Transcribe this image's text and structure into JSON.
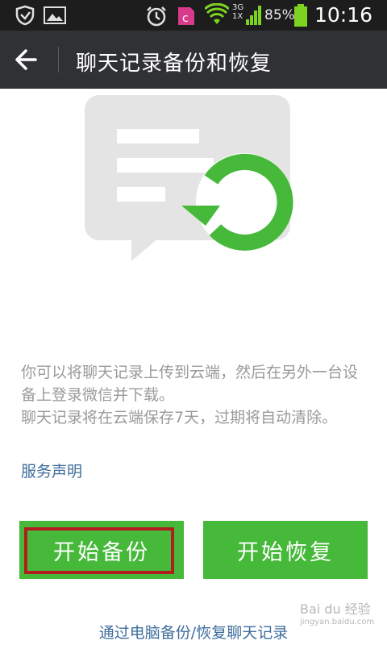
{
  "status_bar": {
    "network_label_top": "3G",
    "network_label_bottom": "1X",
    "battery": "85%",
    "time": "10:16",
    "icons": [
      "shield-icon",
      "image-icon",
      "alarm-icon",
      "app-c-icon",
      "wifi-icon",
      "signal-icon",
      "battery-icon"
    ]
  },
  "action_bar": {
    "title": "聊天记录备份和恢复"
  },
  "description": {
    "line1": "你可以将聊天记录上传到云端，然后在另外一台设备上登录微信并下载。",
    "line2": "聊天记录将在云端保存7天，过期将自动清除。"
  },
  "links": {
    "terms": "服务声明",
    "pc_backup": "通过电脑备份/恢复聊天记录"
  },
  "buttons": {
    "backup": "开始备份",
    "restore": "开始恢复"
  },
  "watermark": {
    "text": "Bai du 经验",
    "sub": "jingyan.baidu.com"
  },
  "colors": {
    "accent_green": "#46b93a",
    "link_blue": "#3e6d9c",
    "highlight_red": "#b01e1e",
    "actionbar_bg": "#2f3134"
  }
}
